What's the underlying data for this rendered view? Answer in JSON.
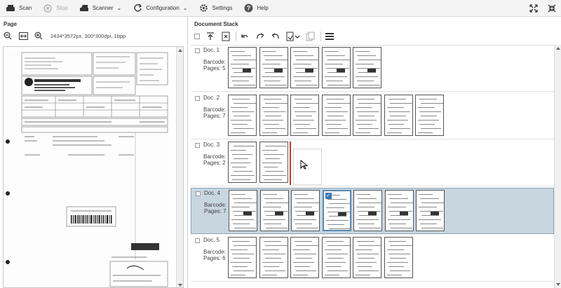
{
  "toolbar": {
    "scan": {
      "label": "Scan",
      "icon": "scanner-icon"
    },
    "stop": {
      "label": "Stop",
      "icon": "stop-icon",
      "disabled": true
    },
    "scanner": {
      "label": "Scanner",
      "icon": "scanner-device-icon"
    },
    "configuration": {
      "label": "Configuration",
      "icon": "refresh-config-icon"
    },
    "settings": {
      "label": "Settings",
      "icon": "gear-icon"
    },
    "help": {
      "label": "Help",
      "icon": "help-icon"
    },
    "expand_icon": "expand-icon",
    "collapse_icon": "collapse-icon"
  },
  "page_panel": {
    "title": "Page",
    "info": "2434*3572px, 300*300dpi, 1bpp"
  },
  "document_stack": {
    "title": "Document Stack",
    "documents": [
      {
        "name": "Doc. 1",
        "barcode": "Barcode:",
        "pages": "Pages: 5",
        "thumbs": 5
      },
      {
        "name": "Doc. 2",
        "barcode": "Barcode:",
        "pages": "Pages: 7",
        "thumbs": 7
      },
      {
        "name": "Doc. 3",
        "barcode": "Barcode:",
        "pages": "Pages: 2",
        "thumbs": 2
      },
      {
        "name": "Doc. 4",
        "barcode": "Barcode:",
        "pages": "Pages: 7",
        "thumbs": 7,
        "selected": true
      },
      {
        "name": "Doc. 5",
        "barcode": "Barcode:",
        "pages": "Pages: 6",
        "thumbs": 6
      }
    ]
  },
  "colors": {
    "accent": "#3c78b5",
    "selection": "#c8d6e0",
    "drop_marker": "#c0392b"
  }
}
